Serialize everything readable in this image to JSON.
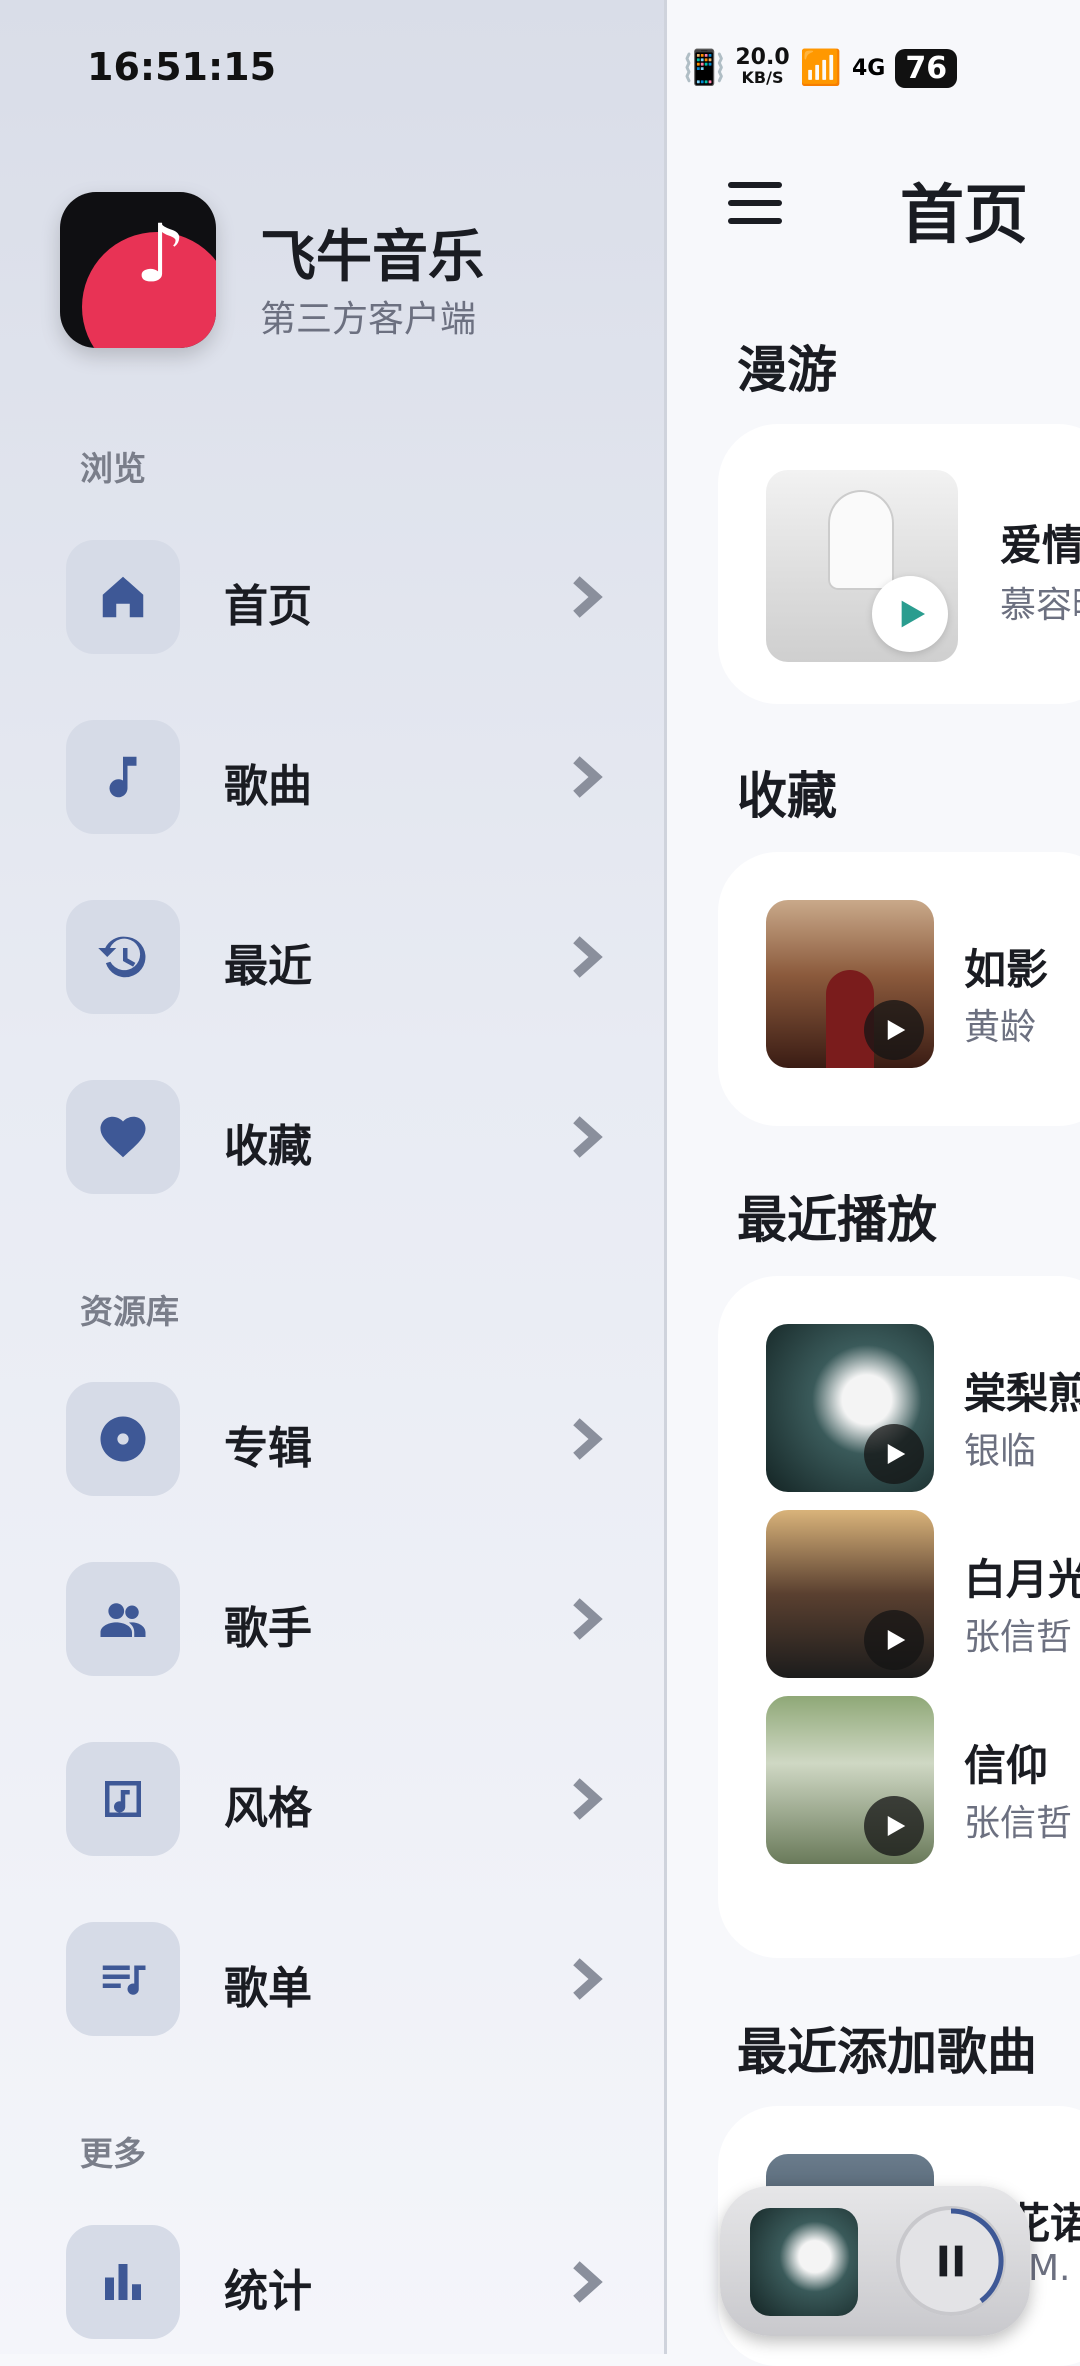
{
  "status_left": {
    "time": "16:51:15"
  },
  "status_right": {
    "speed_value": "20.0",
    "speed_unit": "KB/S",
    "network": "4G",
    "battery": "76"
  },
  "app": {
    "name": "飞牛音乐",
    "subtitle": "第三方客户端"
  },
  "drawer": {
    "sections": {
      "browse": "浏览",
      "library": "资源库",
      "more": "更多"
    },
    "items": [
      {
        "label": "首页",
        "icon": "home-icon"
      },
      {
        "label": "歌曲",
        "icon": "music-note-icon"
      },
      {
        "label": "最近",
        "icon": "history-icon"
      },
      {
        "label": "收藏",
        "icon": "heart-icon"
      },
      {
        "label": "专辑",
        "icon": "album-disc-icon"
      },
      {
        "label": "歌手",
        "icon": "people-icon"
      },
      {
        "label": "风格",
        "icon": "music-box-icon"
      },
      {
        "label": "歌单",
        "icon": "playlist-icon"
      },
      {
        "label": "统计",
        "icon": "bar-chart-icon"
      }
    ]
  },
  "main": {
    "title": "首页",
    "sections": {
      "roam": "漫游",
      "favorites": "收藏",
      "recent": "最近播放",
      "recently_added": "最近添加歌曲"
    },
    "roam_item": {
      "title": "爱情",
      "artist": "慕容晓"
    },
    "favorite_item": {
      "title": "如影",
      "artist": "黄龄"
    },
    "recent_items": [
      {
        "title": "棠梨煎",
        "artist": "银临"
      },
      {
        "title": "白月光",
        "artist": "张信哲"
      },
      {
        "title": "信仰",
        "artist": "张信哲"
      }
    ],
    "recently_added_item": {
      "title": "花诺",
      "artist": "M."
    }
  },
  "colors": {
    "accent": "#3e5896",
    "brand": "#e83355",
    "play_teal": "#2a9d8f"
  }
}
